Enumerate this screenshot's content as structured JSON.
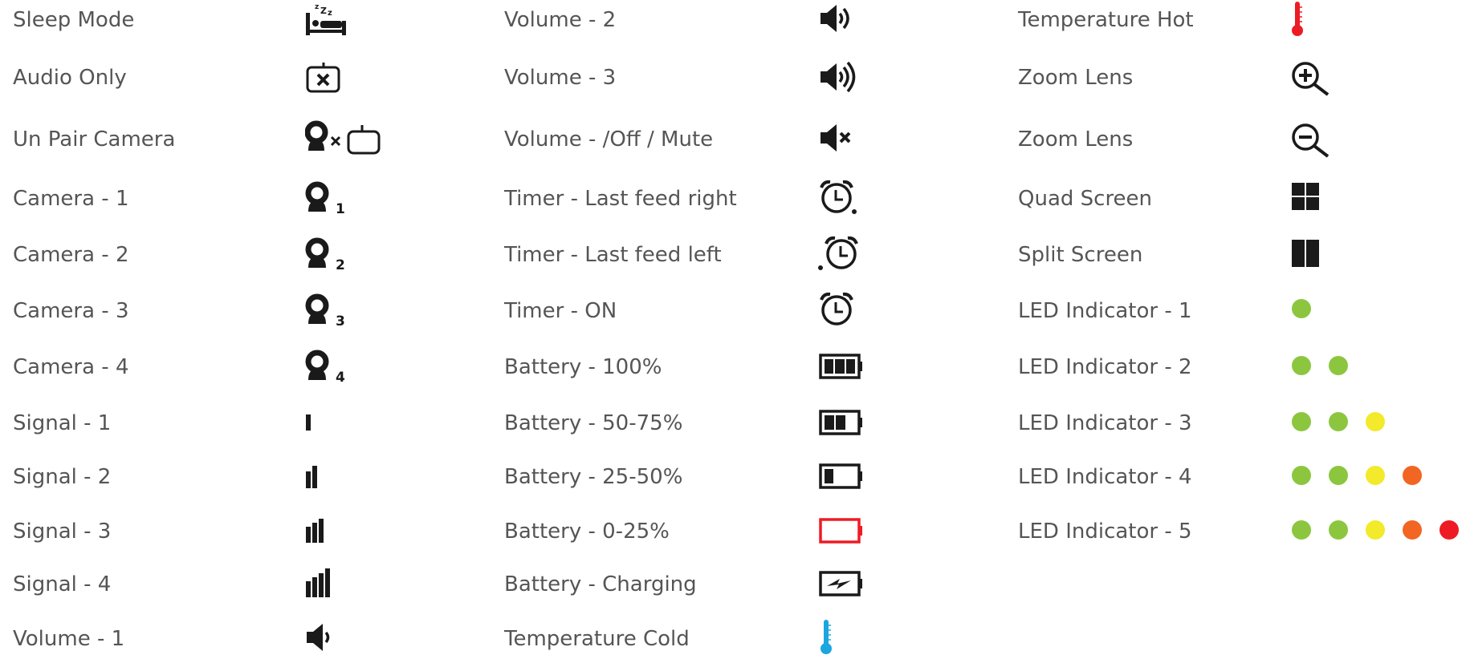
{
  "colors": {
    "icon": "#1a1a1a",
    "text": "#555555",
    "green": "#8cc63f",
    "yellow": "#f2ea2a",
    "orange": "#f26522",
    "red": "#ed1c24",
    "cold": "#1ba6e0"
  },
  "columns": [
    {
      "items": [
        {
          "label": "Sleep Mode",
          "icon": "sleep-icon"
        },
        {
          "label": "Audio Only",
          "icon": "audio-only-icon"
        },
        {
          "label": "Un Pair Camera",
          "icon": "unpair-camera-icon"
        },
        {
          "label": "Camera - 1",
          "icon": "camera-1-icon",
          "badge": "1"
        },
        {
          "label": "Camera - 2",
          "icon": "camera-2-icon",
          "badge": "2"
        },
        {
          "label": "Camera - 3",
          "icon": "camera-3-icon",
          "badge": "3"
        },
        {
          "label": "Camera - 4",
          "icon": "camera-4-icon",
          "badge": "4"
        },
        {
          "label": "Signal - 1",
          "icon": "signal-1-icon"
        },
        {
          "label": "Signal - 2",
          "icon": "signal-2-icon"
        },
        {
          "label": "Signal - 3",
          "icon": "signal-3-icon"
        },
        {
          "label": "Signal - 4",
          "icon": "signal-4-icon"
        },
        {
          "label": "Volume - 1",
          "icon": "volume-1-icon"
        }
      ]
    },
    {
      "items": [
        {
          "label": "Volume - 2",
          "icon": "volume-2-icon"
        },
        {
          "label": "Volume - 3",
          "icon": "volume-3-icon"
        },
        {
          "label": "Volume - /Off / Mute",
          "icon": "volume-mute-icon"
        },
        {
          "label": "Timer - Last feed right",
          "icon": "timer-right-icon"
        },
        {
          "label": "Timer - Last feed left",
          "icon": "timer-left-icon"
        },
        {
          "label": "Timer - ON",
          "icon": "timer-on-icon"
        },
        {
          "label": "Battery - 100%",
          "icon": "battery-100-icon"
        },
        {
          "label": "Battery - 50-75%",
          "icon": "battery-50-75-icon"
        },
        {
          "label": "Battery - 25-50%",
          "icon": "battery-25-50-icon"
        },
        {
          "label": "Battery - 0-25%",
          "icon": "battery-0-25-icon"
        },
        {
          "label": "Battery - Charging",
          "icon": "battery-charging-icon"
        },
        {
          "label": "Temperature Cold",
          "icon": "temperature-cold-icon"
        }
      ]
    },
    {
      "items": [
        {
          "label": "Temperature Hot",
          "icon": "temperature-hot-icon"
        },
        {
          "label": "Zoom Lens",
          "icon": "zoom-in-icon"
        },
        {
          "label": "Zoom Lens",
          "icon": "zoom-out-icon"
        },
        {
          "label": "Quad Screen",
          "icon": "quad-screen-icon"
        },
        {
          "label": "Split Screen",
          "icon": "split-screen-icon"
        },
        {
          "label": "LED Indicator - 1",
          "icon": "led-indicator-1-icon"
        },
        {
          "label": "LED Indicator - 2",
          "icon": "led-indicator-2-icon"
        },
        {
          "label": "LED Indicator - 3",
          "icon": "led-indicator-3-icon"
        },
        {
          "label": "LED Indicator - 4",
          "icon": "led-indicator-4-icon"
        },
        {
          "label": "LED Indicator - 5",
          "icon": "led-indicator-5-icon"
        }
      ]
    }
  ]
}
